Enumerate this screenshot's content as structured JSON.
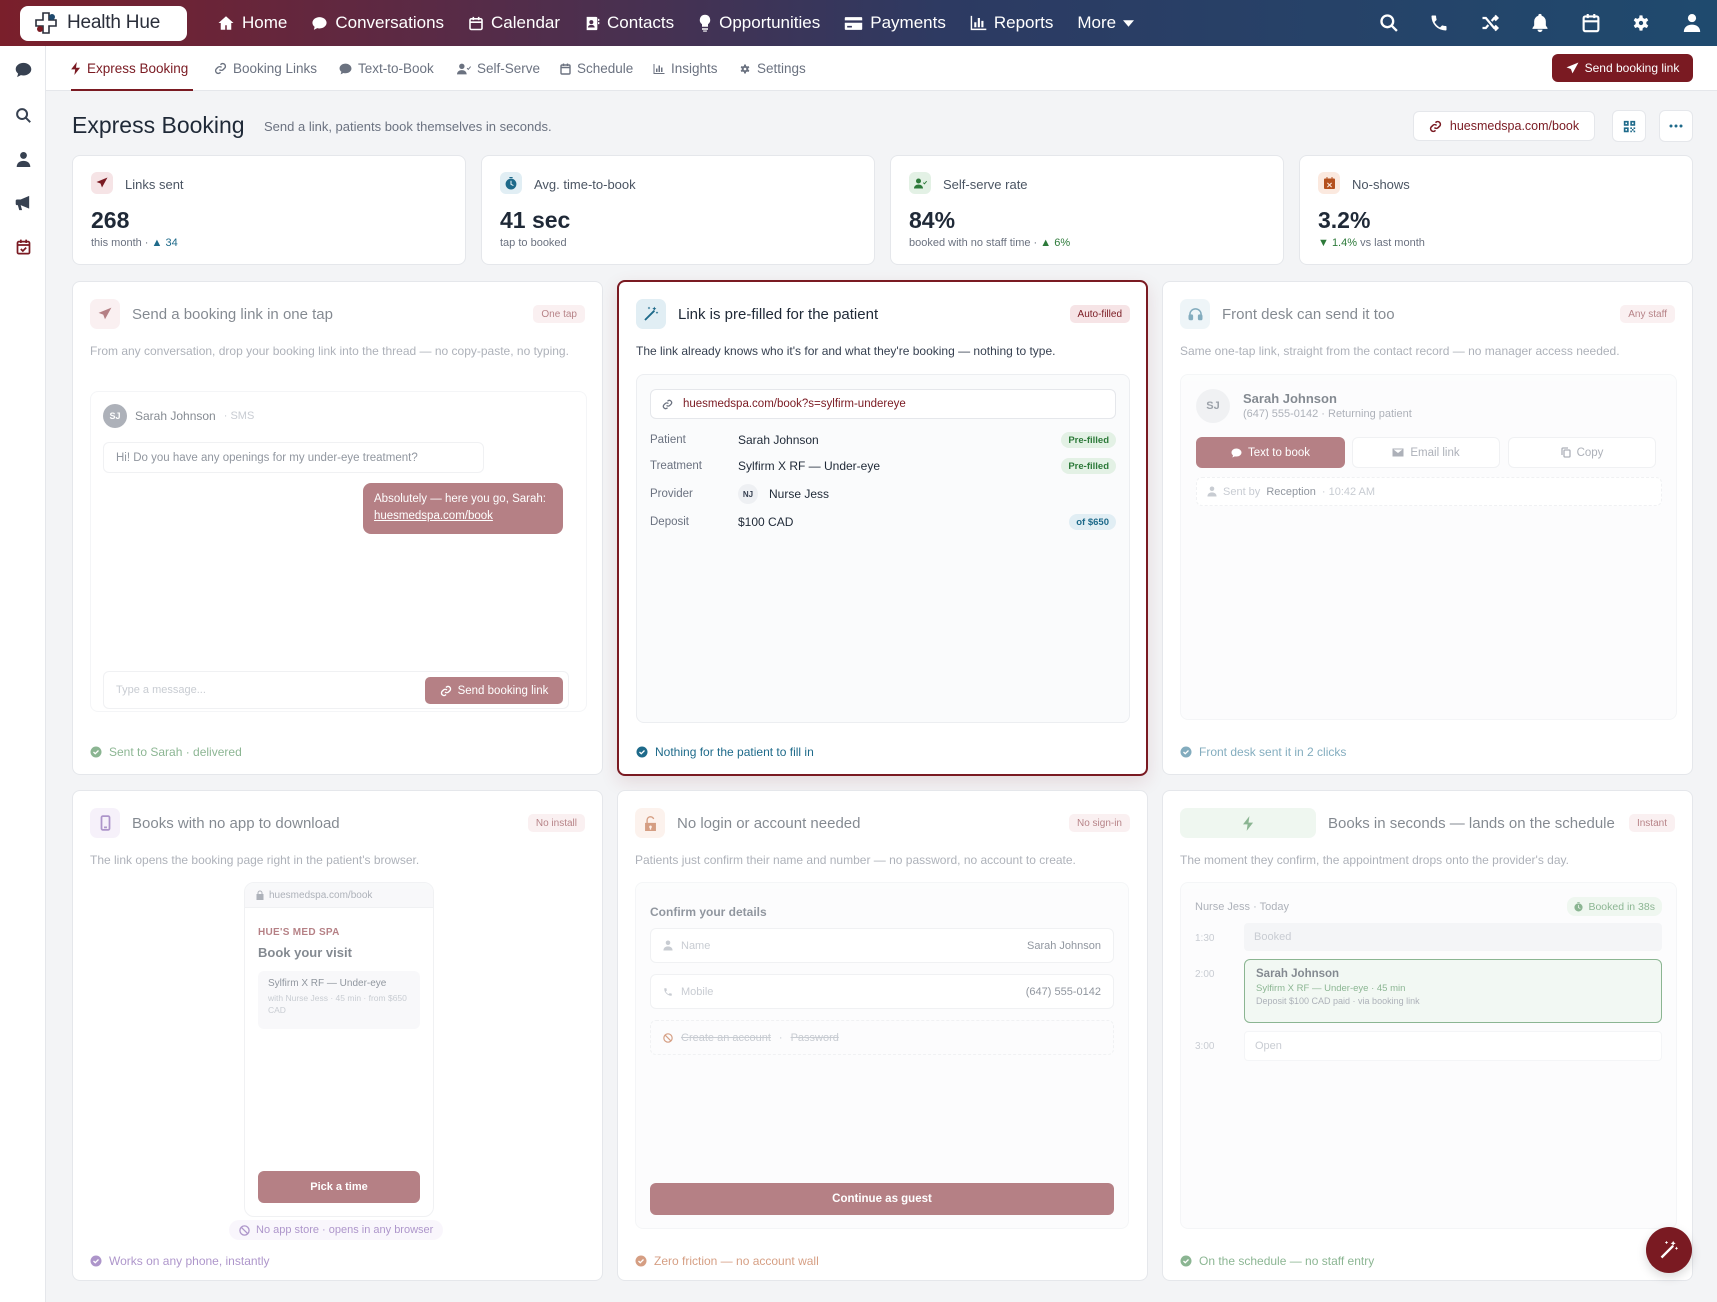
{
  "app": {
    "name": "Health Hue"
  },
  "topnav": {
    "items": [
      {
        "label": "Home",
        "icon": "home-icon"
      },
      {
        "label": "Conversations",
        "icon": "chat-icon"
      },
      {
        "label": "Calendar",
        "icon": "calendar-icon"
      },
      {
        "label": "Contacts",
        "icon": "contacts-icon"
      },
      {
        "label": "Opportunities",
        "icon": "lightbulb-icon"
      },
      {
        "label": "Payments",
        "icon": "card-icon"
      },
      {
        "label": "Reports",
        "icon": "chart-icon"
      },
      {
        "label": "More",
        "icon": "chevron-down-icon"
      }
    ],
    "right_icons": [
      "search-icon",
      "phone-icon",
      "shuffle-icon",
      "bell-icon",
      "calendar-icon",
      "gear-icon",
      "user-icon"
    ]
  },
  "sidebar": {
    "icons": [
      "chat-icon",
      "search-icon",
      "user-icon",
      "megaphone-icon",
      "calendar-check-icon"
    ]
  },
  "subnav": {
    "tabs": [
      {
        "label": "Express Booking",
        "active": true
      },
      {
        "label": "Booking Links"
      },
      {
        "label": "Text-to-Book"
      },
      {
        "label": "Self-Serve"
      },
      {
        "label": "Schedule"
      },
      {
        "label": "Insights"
      },
      {
        "label": "Settings"
      }
    ],
    "send_button": "Send booking link"
  },
  "header": {
    "title": "Express Booking",
    "subtitle": "Send a link, patients book themselves in seconds.",
    "url": "huesmedspa.com/book"
  },
  "stats": [
    {
      "label": "Links sent",
      "value": "268",
      "sub": "this month · ",
      "delta": "▲ 34"
    },
    {
      "label": "Avg. time-to-book",
      "value": "41 sec",
      "sub": "tap to booked",
      "delta": ""
    },
    {
      "label": "Self-serve rate",
      "value": "84%",
      "sub": "booked with no staff time · ",
      "delta": "▲ 6%"
    },
    {
      "label": "No-shows",
      "value": "3.2%",
      "sub": " vs last month",
      "delta": "▼ 1.4%"
    }
  ],
  "cards": {
    "one_tap": {
      "title": "Send a booking link in one tap",
      "badge": "One tap",
      "desc": "From any conversation, drop your booking link into the thread — no copy-paste, no typing.",
      "contact": "Sarah Johnson",
      "initials": "SJ",
      "channel": "· SMS",
      "incoming": "Hi! Do you have any openings for my under-eye treatment?",
      "reply": "Absolutely — here you go, Sarah:",
      "reply_link": "huesmedspa.com/book",
      "placeholder": "Type a message...",
      "send": "Send booking link",
      "footer": "Sent to Sarah · delivered"
    },
    "prefilled": {
      "title": "Link is pre-filled for the patient",
      "badge": "Auto-filled",
      "desc": "The link already knows who it's for and what they're booking — nothing to type.",
      "url": "huesmedspa.com/book?s=sylfirm-undereye",
      "rows": [
        {
          "label": "Patient",
          "value": "Sarah Johnson",
          "pill": "Pre-filled"
        },
        {
          "label": "Treatment",
          "value": "Sylfirm X RF — Under-eye",
          "pill": "Pre-filled"
        },
        {
          "label": "Provider",
          "value": "Nurse Jess",
          "initials": "NJ"
        },
        {
          "label": "Deposit",
          "value": "$100 CAD",
          "pill": "of $650"
        }
      ],
      "footer": "Nothing for the patient to fill in"
    },
    "front_desk": {
      "title": "Front desk can send it too",
      "badge": "Any staff",
      "desc": "Same one-tap link, straight from the contact record — no manager access needed.",
      "contact": "Sarah Johnson",
      "initials": "SJ",
      "contact_sub": "(647) 555-0142 · Returning patient",
      "btn_text": "Text to book",
      "btn_email": "Email link",
      "btn_copy": "Copy",
      "sent_by_label": "Sent by",
      "sent_by": "Reception",
      "sent_time": "· 10:42 AM",
      "footer": "Front desk sent it in 2 clicks"
    },
    "no_app": {
      "title": "Books with no app to download",
      "badge": "No install",
      "desc": "The link opens the booking page right in the patient's browser.",
      "url": "huesmedspa.com/book",
      "brand": "HUE'S MED SPA",
      "heading": "Book your visit",
      "item_title": "Sylfirm X RF — Under-eye",
      "item_sub": "with Nurse Jess · 45 min · from $650 CAD",
      "cta": "Pick a time",
      "note": "No app store · opens in any browser",
      "footer": "Works on any phone, instantly"
    },
    "no_login": {
      "title": "No login or account needed",
      "badge": "No sign-in",
      "desc": "Patients just confirm their name and number — no password, no account to create.",
      "form_title": "Confirm your details",
      "name_label": "Name",
      "name_value": "Sarah Johnson",
      "mobile_label": "Mobile",
      "mobile_value": "(647) 555-0142",
      "create_account": "Create an account",
      "sep": "·",
      "password": "Password",
      "cta": "Continue as guest",
      "footer": "Zero friction — no account wall"
    },
    "seconds": {
      "title": "Books in seconds — lands on the schedule",
      "badge": "Instant",
      "desc": "The moment they confirm, the appointment drops onto the provider's day.",
      "schedule_label": "Nurse Jess · Today",
      "booked_pill": "Booked in 38s",
      "slots": [
        {
          "time": "1:30",
          "text": "Booked"
        },
        {
          "time": "2:00",
          "title": "Sarah Johnson",
          "sub1": "Sylfirm X RF — Under-eye · 45 min",
          "sub2": "Deposit $100 CAD paid · via booking link"
        },
        {
          "time": "3:00",
          "text": "Open"
        }
      ],
      "footer": "On the schedule — no staff entry"
    }
  },
  "colors": {
    "brand": "#7a1a22",
    "teal": "#1e6a8a",
    "green": "#2d7a3a",
    "purple": "#6b3fa0",
    "orange": "#b4501e"
  }
}
